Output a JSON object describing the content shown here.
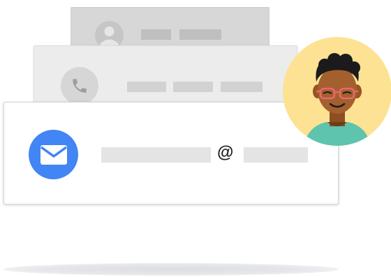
{
  "email_card": {
    "at_symbol": "@"
  },
  "icons": {
    "contact": "person-icon",
    "phone": "phone-icon",
    "email": "envelope-icon",
    "avatar": "person-avatar"
  },
  "colors": {
    "email_badge": "#4285f4",
    "avatar_bg": "#fde293",
    "shirt": "#5ec4ae",
    "glasses": "#e8686b"
  }
}
